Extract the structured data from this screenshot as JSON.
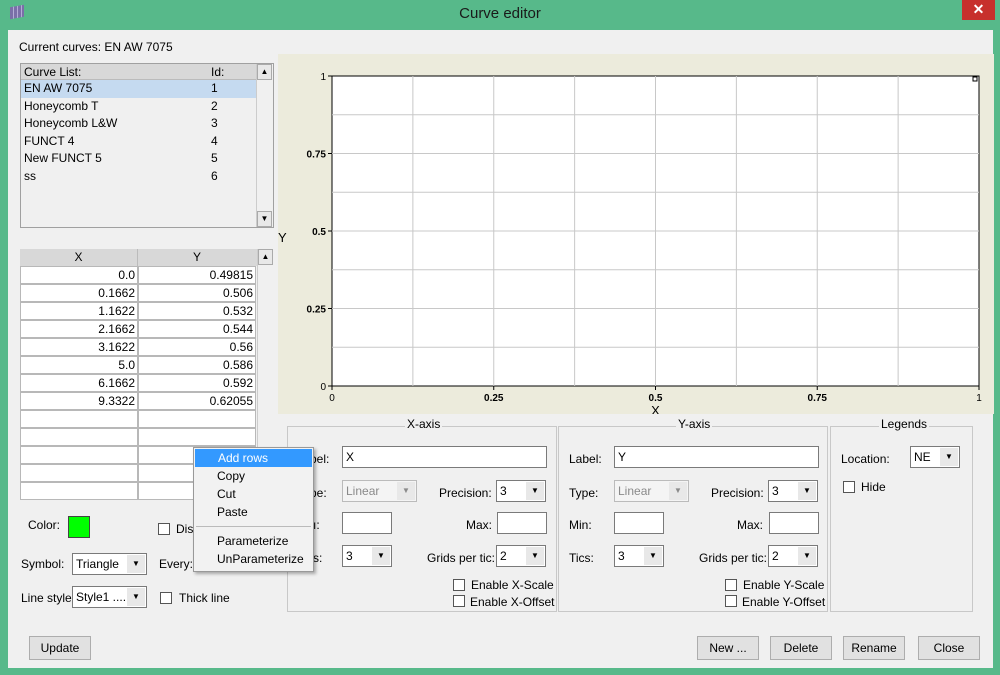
{
  "window": {
    "title": "Curve editor",
    "close": "✕",
    "icon": "grid-app-icon"
  },
  "current_curves": "Current curves: EN AW 7075",
  "curve_list": {
    "headers": [
      "Curve List:",
      "Id:"
    ],
    "items": [
      {
        "name": "EN AW 7075",
        "id": "1",
        "selected": true
      },
      {
        "name": "Honeycomb T",
        "id": "2"
      },
      {
        "name": "Honeycomb L&W",
        "id": "3"
      },
      {
        "name": "FUNCT 4",
        "id": "4"
      },
      {
        "name": "New FUNCT 5",
        "id": "5"
      },
      {
        "name": "ss",
        "id": "6"
      }
    ]
  },
  "points": {
    "headers": [
      "X",
      "Y"
    ],
    "rows": [
      [
        "0.0",
        "0.49815"
      ],
      [
        "0.1662",
        "0.506"
      ],
      [
        "1.1622",
        "0.532"
      ],
      [
        "2.1662",
        "0.544"
      ],
      [
        "3.1622",
        "0.56"
      ],
      [
        "5.0",
        "0.586"
      ],
      [
        "6.1662",
        "0.592"
      ],
      [
        "9.3322",
        "0.62055"
      ],
      [
        "",
        ""
      ],
      [
        "",
        ""
      ],
      [
        "",
        ""
      ],
      [
        "",
        ""
      ],
      [
        "",
        ""
      ]
    ]
  },
  "context_menu": {
    "items": [
      "Add rows",
      "Copy",
      "Cut",
      "Paste",
      "Parameterize",
      "UnParameterize"
    ],
    "highlighted": "Add rows"
  },
  "style": {
    "color_label": "Color:",
    "color": "#00ff00",
    "display_label": "Dis",
    "symbol_label": "Symbol:",
    "symbol": "Triangle",
    "every_label": "Every:",
    "line_style_label": "Line style:",
    "line_style": "Style1 ......",
    "thick_line": "Thick line"
  },
  "chart_data": {
    "type": "line",
    "xlabel": "X",
    "ylabel": "Y",
    "xlim": [
      0,
      1
    ],
    "ylim": [
      0,
      1
    ],
    "xticks": [
      "0",
      "0.25",
      "0.5",
      "0.75",
      "1"
    ],
    "yticks": [
      "0",
      "0.25",
      "0.5",
      "0.75",
      "1"
    ],
    "grid": true,
    "grids_per_tic": 2,
    "points": [
      [
        1,
        1
      ]
    ],
    "background": "#ecebdc"
  },
  "xaxis": {
    "title": "X-axis",
    "label_label": "bel:",
    "label": "X",
    "type_label": "pe:",
    "type": "Linear",
    "precision_label": "Precision:",
    "precision": "3",
    "min_label": "ı:",
    "max_label": "Max:",
    "min": "",
    "max": "",
    "tics_label": "s:",
    "tics": "3",
    "grids_label": "Grids per tic:",
    "grids": "2",
    "scale": "Enable X-Scale",
    "offset": "Enable X-Offset"
  },
  "yaxis": {
    "title": "Y-axis",
    "label_label": "Label:",
    "label": "Y",
    "type_label": "Type:",
    "type": "Linear",
    "precision_label": "Precision:",
    "precision": "3",
    "min_label": "Min:",
    "max_label": "Max:",
    "min": "",
    "max": "",
    "tics_label": "Tics:",
    "tics": "3",
    "grids_label": "Grids per tic:",
    "grids": "2",
    "scale": "Enable Y-Scale",
    "offset": "Enable Y-Offset"
  },
  "legends": {
    "title": "Legends",
    "location_label": "Location:",
    "location": "NE",
    "hide": "Hide"
  },
  "buttons": {
    "update": "Update",
    "new": "New ...",
    "delete": "Delete",
    "rename": "Rename",
    "close": "Close"
  }
}
